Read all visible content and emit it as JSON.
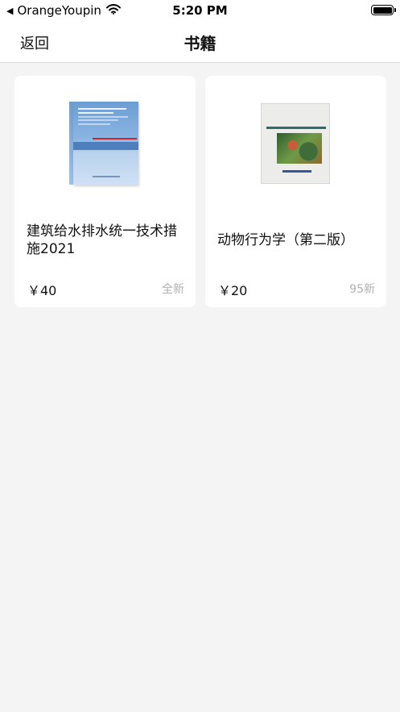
{
  "status_bar": {
    "carrier": "OrangeYoupin",
    "time": "5:20 PM"
  },
  "nav": {
    "back_label": "返回",
    "title": "书籍"
  },
  "books": [
    {
      "title": "建筑给水排水统一技术措施2021",
      "price": "￥40",
      "condition": "全新",
      "cover_color": "#8bb5e2"
    },
    {
      "title": "动物行为学（第二版）",
      "price": "￥20",
      "condition": "95新",
      "cover_color": "#ececea"
    }
  ],
  "colors": {
    "background": "#f4f4f4",
    "card": "#ffffff",
    "muted_text": "#b0b0b0"
  }
}
